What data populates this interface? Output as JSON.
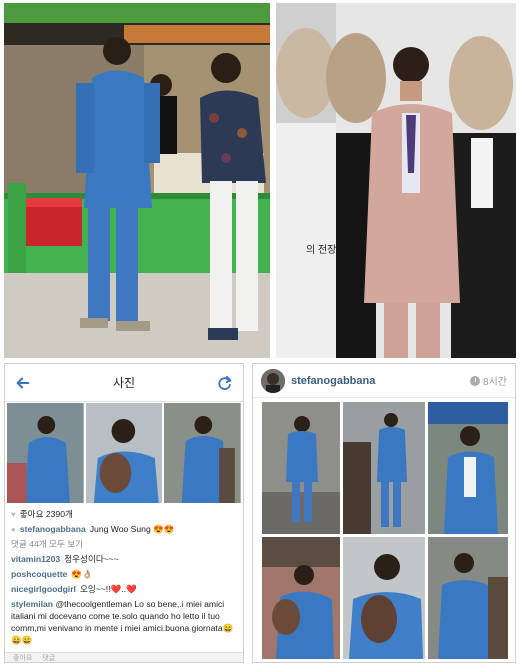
{
  "left_post": {
    "header_title": "사진",
    "likes": "좋아요 2390개",
    "caption_user": "stefanogabbana",
    "caption_text": "Jung Woo Sung 😍😍",
    "view_comments": "댓글 44개 모두 보기",
    "comments": [
      {
        "user": "vitamin1203",
        "text": "정우성이다~~~"
      },
      {
        "user": "poshcoquette",
        "text": "😍👌🏼"
      },
      {
        "user": "nicegirlgoodgirl",
        "text": "오잉~~!!❤️..❤️"
      },
      {
        "user": "stylemilan",
        "text": "@thecoolgentleman Lo so bene,.i miei amici italiani mi docevano come te.solo quando ho letto il tuo comm,mi venivano in mente i miei amici.buona giornata😄😄😄"
      }
    ],
    "footer_like": "좋아요",
    "footer_comment": "댓글"
  },
  "right_post": {
    "username": "stefanogabbana",
    "time": "8시간"
  },
  "poster_text": "의 전장",
  "colors": {
    "jacket_blue": "#3a79c2",
    "pink_suit": "#d2a79c",
    "booth_green": "#43b350",
    "ig_link": "#3b5d7c"
  }
}
